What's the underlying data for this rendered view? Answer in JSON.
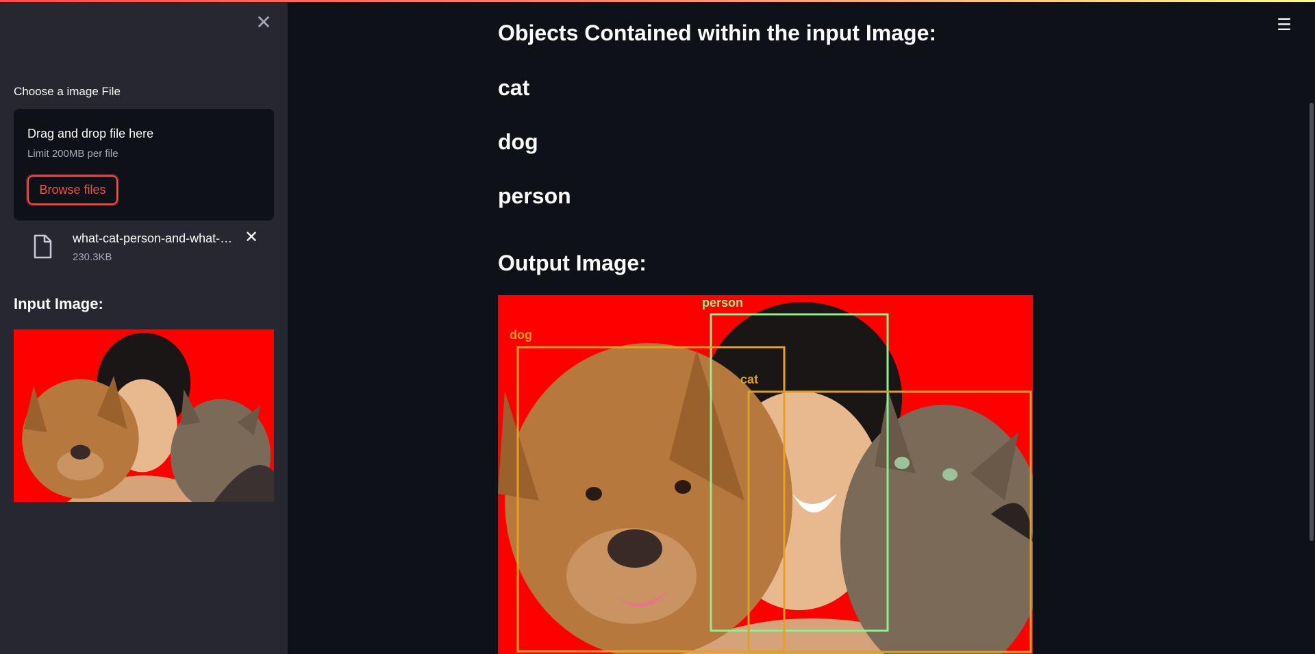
{
  "sidebar": {
    "close_icon": "close-icon",
    "uploader_label": "Choose a image File",
    "dropzone_title": "Drag and drop file here",
    "dropzone_limit": "Limit 200MB per file",
    "browse_label": "Browse files",
    "file": {
      "name": "what-cat-person-and-what-…",
      "size": "230.3KB",
      "icon": "file-icon",
      "remove_icon": "close-icon"
    },
    "input_heading": "Input Image:"
  },
  "main": {
    "objects_heading": "Objects Contained within the input Image:",
    "objects": [
      "cat",
      "dog",
      "person"
    ],
    "output_heading": "Output Image:",
    "detections": [
      {
        "label": "person",
        "color": "#90ee90"
      },
      {
        "label": "dog",
        "color": "#e8a023"
      },
      {
        "label": "cat",
        "color": "#d9a02e"
      }
    ]
  },
  "menu_icon": "hamburger-menu-icon",
  "colors": {
    "accent": "#ff4b4b",
    "background": "#0e1117",
    "sidebar": "#262730",
    "photo_backdrop": "#ff0000"
  }
}
